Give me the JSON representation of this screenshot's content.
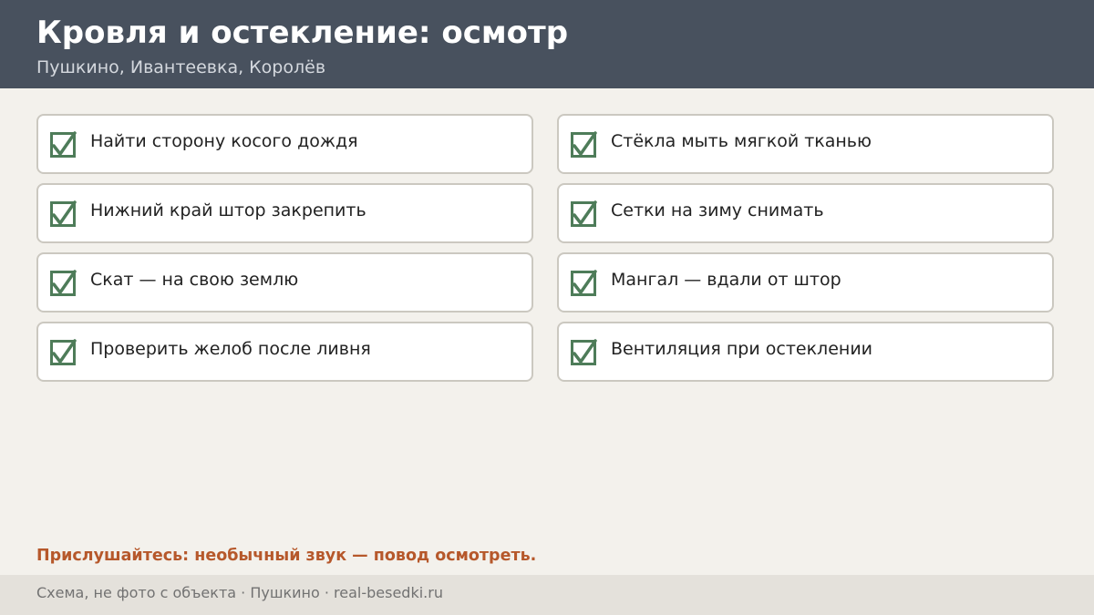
{
  "header": {
    "title": "Кровля и остекление: осмотр",
    "subtitle": "Пушкино, Ивантеевка, Королёв"
  },
  "checklist": {
    "items": [
      {
        "label": "Найти сторону косого дождя",
        "checked": true
      },
      {
        "label": "Стёкла мыть мягкой тканью",
        "checked": true
      },
      {
        "label": "Нижний край штор закрепить",
        "checked": true
      },
      {
        "label": "Сетки на зиму снимать",
        "checked": true
      },
      {
        "label": "Скат — на свою землю",
        "checked": true
      },
      {
        "label": "Мангал — вдали от штор",
        "checked": true
      },
      {
        "label": "Проверить желоб после ливня",
        "checked": true
      },
      {
        "label": "Вентиляция при остеклении",
        "checked": true
      }
    ]
  },
  "note": "Прислушайтесь: необычный звук — повод осмотреть.",
  "footer": {
    "text": "Схема, не фото с объекта  ·  Пушкино  ·  real-besedki.ru"
  },
  "colors": {
    "header_bg": "#48515e",
    "accent_check": "#4e7c59",
    "note": "#b6582b",
    "page_bg": "#f3f1ec"
  },
  "icons": {
    "check": "checkmark-icon"
  }
}
